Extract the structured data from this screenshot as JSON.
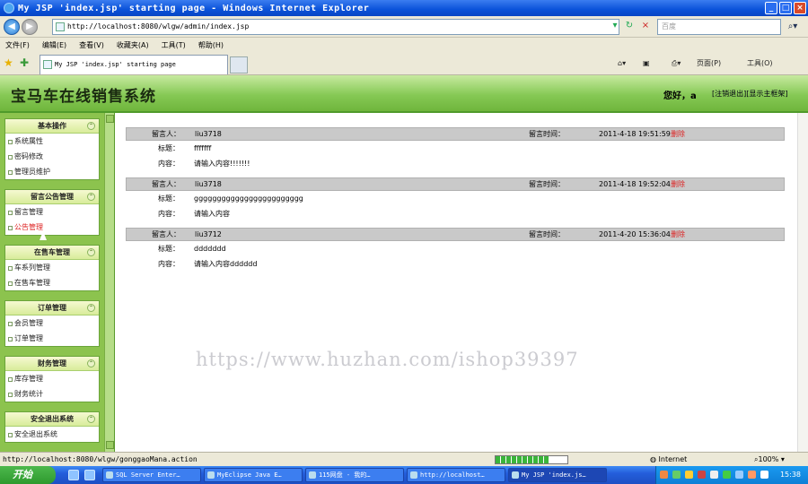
{
  "window": {
    "title": "My JSP 'index.jsp' starting page - Windows Internet Explorer",
    "min": "_",
    "max": "□",
    "close": "×"
  },
  "address": {
    "url": "http://localhost:8080/wlgw/admin/index.jsp",
    "search_placeholder": "百度"
  },
  "menu": [
    "文件(F)",
    "编辑(E)",
    "查看(V)",
    "收藏夹(A)",
    "工具(T)",
    "帮助(H)"
  ],
  "tab": {
    "label": "My JSP 'index.jsp' starting page"
  },
  "toolbar": {
    "page": "页面(P)",
    "tools": "工具(O)"
  },
  "banner": {
    "title": "宝马车在线销售系统",
    "greeting": "您好，a",
    "logout": "[注销退出]",
    "home": "[显示主框架]"
  },
  "sidebar": [
    {
      "title": "基本操作",
      "items": [
        "系统属性",
        "密码修改",
        "管理员维护"
      ]
    },
    {
      "title": "留言公告管理",
      "items": [
        "留言管理",
        "公告管理"
      ]
    },
    {
      "title": "在售车管理",
      "items": [
        "车系列管理",
        "在售车管理"
      ]
    },
    {
      "title": "订单管理",
      "items": [
        "会员管理",
        "订单管理"
      ]
    },
    {
      "title": "财务管理",
      "items": [
        "库存管理",
        "财务统计"
      ]
    },
    {
      "title": "安全退出系统",
      "items": [
        "安全退出系统"
      ]
    }
  ],
  "labels": {
    "author": "留言人：",
    "time": "留言时间：",
    "title": "标题：",
    "content": "内容：",
    "delete": "删除"
  },
  "messages": [
    {
      "author": "liu3718",
      "time": "2011-4-18 19:51:59",
      "title": "fffffff",
      "content": "请输入内容!!!!!!!"
    },
    {
      "author": "liu3718",
      "time": "2011-4-18 19:52:04",
      "title": "gggggggggggggggggggggggg",
      "content": "请输入内容"
    },
    {
      "author": "liu3712",
      "time": "2011-4-20 15:36:04",
      "title": "ddddddd",
      "content": "请输入内容dddddd"
    }
  ],
  "watermark": "https://www.huzhan.com/ishop39397",
  "status": {
    "url": "http://localhost:8080/wlgw/gonggaoMana.action",
    "zone": "Internet",
    "zoom": "100%",
    "progress": 0.75
  },
  "taskbar": {
    "start": "开始",
    "items": [
      "SQL Server Enter…",
      "MyEclipse Java E…",
      "115网盘 - 我的…",
      "http://localhost…",
      "My JSP 'index.js…"
    ],
    "clock": "15:38"
  }
}
